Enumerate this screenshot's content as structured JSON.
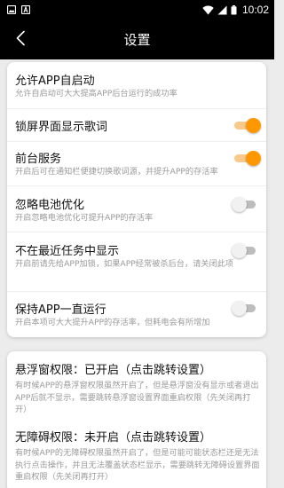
{
  "status_bar": {
    "time": "10:02",
    "left_icons": [
      "image-icon",
      "text-a-icon"
    ],
    "right_icons": [
      "wifi-icon",
      "signal-icon",
      "battery-icon"
    ]
  },
  "toolbar": {
    "title": "设置",
    "back_icon": "chevron-left-icon"
  },
  "settings": [
    {
      "title": "允许APP自启动",
      "subtitle": "允许自启动可大大提高APP后台运行的成功率",
      "has_toggle": false
    },
    {
      "title": "锁屏界面显示歌词",
      "subtitle": "",
      "has_toggle": true,
      "on": true
    },
    {
      "title": "前台服务",
      "subtitle": "开启后可在通知栏便捷切换歌词源，并提升APP的存活率",
      "has_toggle": true,
      "on": true
    },
    {
      "title": "忽略电池优化",
      "subtitle": "开启忽略电池优化可提升APP的存活率",
      "has_toggle": true,
      "on": false
    },
    {
      "title": "不在最近任务中显示",
      "subtitle": "开启前请先给APP加锁，如果APP经常被杀后台，请关闭此项",
      "has_toggle": true,
      "on": false
    },
    {
      "title": "保持APP一直运行",
      "subtitle": "开启本项可大大提升APP的存活率，但耗电会有所增加",
      "has_toggle": true,
      "on": false
    }
  ],
  "permissions": [
    {
      "title": "悬浮窗权限：已开启（点击跳转设置）",
      "description": "有时候APP的悬浮窗权限虽然开启了，但是悬浮窗没有显示或者退出APP后就不显示，需要跳转悬浮窗设置界面重启权限（先关闭再打开）"
    },
    {
      "title": "无障碍权限：未开启（点击跳转设置）",
      "description": "有时候APP的无障碍权限虽然开启了，但是可能可能状态栏还是无法执行点击操作，并且无法覆盖状态栏显示，需要跳转无障碍设置界面重启权限（先关闭再打开）"
    }
  ],
  "colors": {
    "accent": "#ff9800",
    "toolbar_bg": "#000000",
    "page_bg": "#ececec"
  }
}
